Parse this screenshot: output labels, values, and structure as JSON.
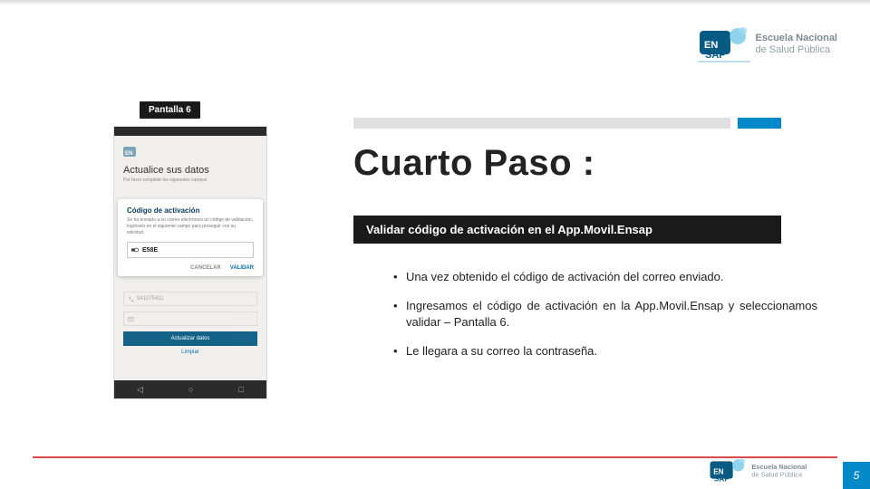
{
  "brand": {
    "name": "ENSAP",
    "line1": "Escuela Nacional",
    "line2": "de Salud Pública"
  },
  "phone": {
    "caption": "Pantalla 6",
    "screen_title": "Actualice sus datos",
    "screen_sub": "Por favor complete los siguientes campos",
    "modal_title": "Código de activación",
    "modal_sub": "Se ha enviado a su correo electrónico un código de validación, ingréselo en el siguiente campo para proseguir con su solicitud.",
    "modal_value": "E58E",
    "modal_cancel": "CANCELAR",
    "modal_validate": "VALIDAR",
    "field1": "941075411",
    "button": "Actualizar datos",
    "link": "Limpiar"
  },
  "content": {
    "title": "Cuarto Paso :",
    "subtitle": "Validar código de activación en el App.Movil.Ensap",
    "bullets": [
      "Una vez obtenido el código de activación del correo enviado.",
      "Ingresamos el código de activación en la App.Movil.Ensap y seleccionamos validar – Pantalla 6.",
      "Le llegara a su correo la contraseña."
    ]
  },
  "page": "5"
}
